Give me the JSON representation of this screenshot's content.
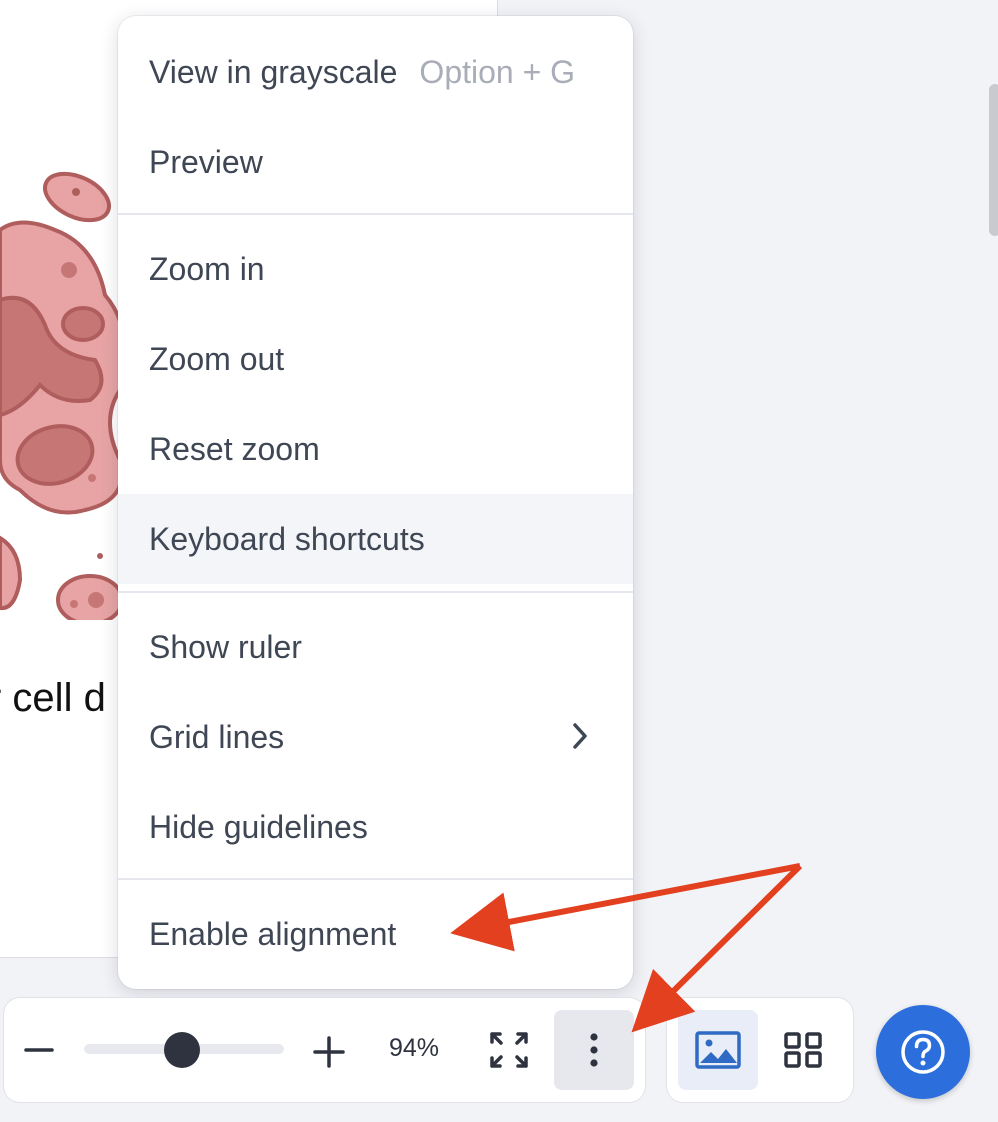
{
  "canvas": {
    "text_fragment": "r cell d"
  },
  "menu": {
    "items": [
      {
        "label": "View in grayscale",
        "shortcut": "Option + G"
      },
      {
        "label": "Preview"
      },
      {
        "label": "Zoom in"
      },
      {
        "label": "Zoom out"
      },
      {
        "label": "Reset zoom"
      },
      {
        "label": "Keyboard shortcuts",
        "highlighted": true
      },
      {
        "label": "Show ruler"
      },
      {
        "label": "Grid lines",
        "has_submenu": true
      },
      {
        "label": "Hide guidelines"
      },
      {
        "label": "Enable alignment"
      }
    ]
  },
  "toolbar": {
    "zoom_level": "94%",
    "zoom_slider_value_percent": 94,
    "icons": [
      "minus-icon",
      "plus-icon",
      "fullscreen-icon",
      "more-vertical-icon",
      "image-view-icon",
      "grid-view-icon",
      "help-icon"
    ]
  },
  "colors": {
    "accent": "#2c6fdc",
    "annotation_arrow": "#e2401f",
    "menu_text": "#3f4654",
    "shortcut_text": "#a9adb8",
    "illustration_fill": "#e8a4a4",
    "illustration_stroke": "#b05d5d"
  }
}
